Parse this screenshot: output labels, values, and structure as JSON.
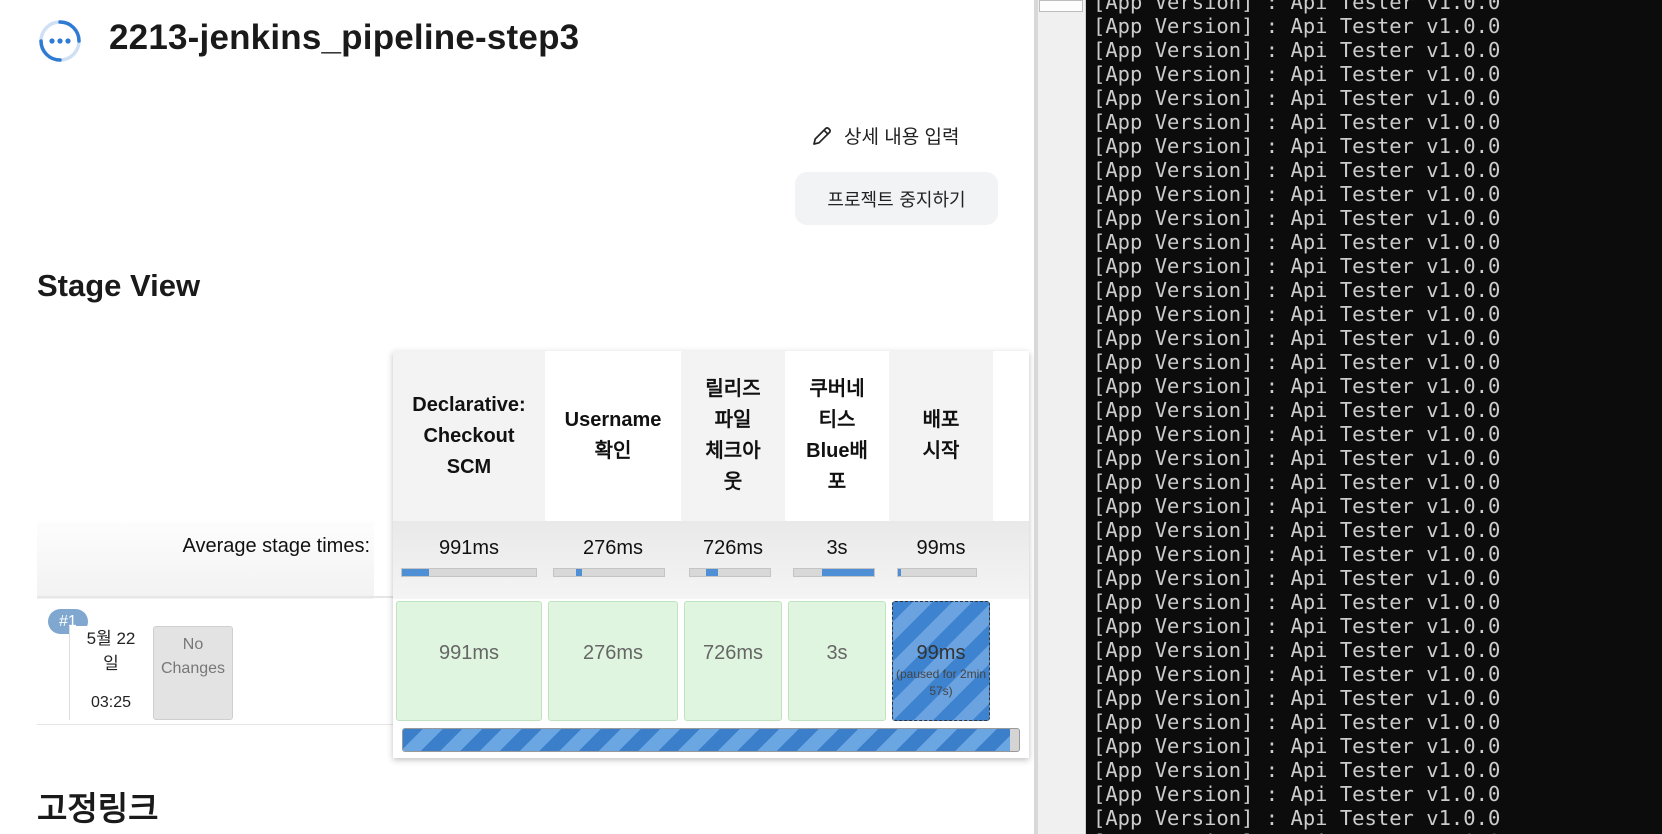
{
  "job": {
    "title": "2213-jenkins_pipeline-step3",
    "status": "running"
  },
  "actions": {
    "edit_description": "상세 내용 입력",
    "stop_project": "프로젝트 중지하기"
  },
  "stage_view": {
    "title": "Stage View",
    "average_label": "Average stage times:",
    "stages": [
      {
        "name": "Declarative: Checkout SCM",
        "lines": [
          "Declarative:",
          "Checkout",
          "SCM"
        ],
        "avg": "991ms",
        "avg_fraction": 0.2,
        "run": "991ms"
      },
      {
        "name": "Username 확인",
        "lines": [
          "Username",
          "확인"
        ],
        "avg": "276ms",
        "avg_fraction": 0.05,
        "run": "276ms"
      },
      {
        "name": "릴리즈 파일 체크아웃",
        "lines": [
          "릴리즈",
          "파일",
          "체크아",
          "웃"
        ],
        "avg": "726ms",
        "avg_fraction": 0.15,
        "run": "726ms"
      },
      {
        "name": "쿠버네티스 Blue배포",
        "lines": [
          "쿠버네",
          "티스",
          "Blue배",
          "포"
        ],
        "avg": "3s",
        "avg_fraction": 0.65,
        "run": "3s"
      },
      {
        "name": "배포 시작",
        "lines": [
          "배포",
          "시작"
        ],
        "avg": "99ms",
        "avg_fraction": 0.02,
        "run": "99ms",
        "run_note_lines": [
          "(paused for 2min",
          "57s)"
        ]
      }
    ],
    "build": {
      "number": "#1",
      "date_lines": [
        "5월 22",
        "일"
      ],
      "time": "03:25",
      "changes_lines": [
        "No",
        "Changes"
      ]
    },
    "progress_fraction": 0.985
  },
  "permalinks_title": "고정링크",
  "terminal": {
    "line_text": "[App Version] : Api Tester v1.0.0",
    "line_count": 36
  },
  "colors": {
    "stage_success": "#dff5df",
    "progress_blue": "#3b7fcb",
    "terminal_bg": "#0c0c0c",
    "terminal_text": "#cccccc"
  }
}
